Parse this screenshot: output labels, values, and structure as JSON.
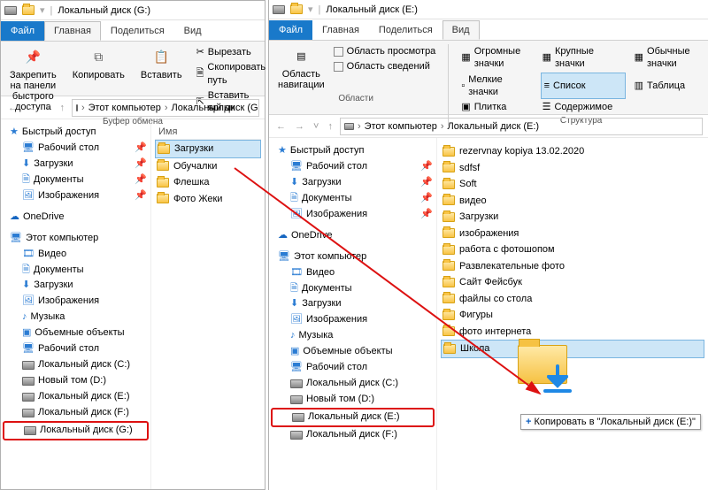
{
  "left": {
    "title": "Локальный диск (G:)",
    "tabs": {
      "file": "Файл",
      "home": "Главная",
      "share": "Поделиться",
      "view": "Вид"
    },
    "ribbon": {
      "pin": "Закрепить на панели\nбыстрого доступа",
      "copy": "Копировать",
      "paste": "Вставить",
      "cut": "Вырезать",
      "copypath": "Скопировать путь",
      "pasteshortcut": "Вставить ярлык",
      "group": "Буфер обмена"
    },
    "breadcrumb": {
      "pc": "Этот компьютер",
      "disk": "Локальный диск (G:"
    },
    "tree": {
      "quick": "Быстрый доступ",
      "desktop": "Рабочий стол",
      "downloads": "Загрузки",
      "documents": "Документы",
      "pictures": "Изображения",
      "onedrive": "OneDrive",
      "thispc": "Этот компьютер",
      "video": "Видео",
      "docs2": "Документы",
      "dl2": "Загрузки",
      "pic2": "Изображения",
      "music": "Музыка",
      "objects": "Объемные объекты",
      "desk2": "Рабочий стол",
      "diskC": "Локальный диск (C:)",
      "diskD": "Новый том (D:)",
      "diskE": "Локальный диск (E:)",
      "diskF": "Локальный диск (F:)",
      "diskG": "Локальный диск (G:)"
    },
    "content": {
      "header": "Имя",
      "items": [
        "Загрузки",
        "Обучалки",
        "Флешка",
        "Фото Жеки"
      ]
    }
  },
  "right": {
    "title": "Локальный диск (E:)",
    "tabs": {
      "file": "Файл",
      "home": "Главная",
      "share": "Поделиться",
      "view": "Вид"
    },
    "ribbon": {
      "navpane": "Область\nнавигации",
      "preview": "Область просмотра",
      "details": "Область сведений",
      "group1": "Области",
      "huge": "Огромные значки",
      "large": "Крупные значки",
      "normal": "Обычные значки",
      "small": "Мелкие значки",
      "list": "Список",
      "table": "Таблица",
      "tiles": "Плитка",
      "contents": "Содержимое",
      "group2": "Структура"
    },
    "breadcrumb": {
      "pc": "Этот компьютер",
      "disk": "Локальный диск (E:)"
    },
    "tree": {
      "quick": "Быстрый доступ",
      "desktop": "Рабочий стол",
      "downloads": "Загрузки",
      "documents": "Документы",
      "pictures": "Изображения",
      "onedrive": "OneDrive",
      "thispc": "Этот компьютер",
      "video": "Видео",
      "docs2": "Документы",
      "dl2": "Загрузки",
      "pic2": "Изображения",
      "music": "Музыка",
      "objects": "Объемные объекты",
      "desk2": "Рабочий стол",
      "diskC": "Локальный диск (C:)",
      "diskD": "Новый том (D:)",
      "diskE": "Локальный диск (E:)",
      "diskF": "Локальный диск (F:)"
    },
    "content": {
      "items": [
        "rezervnay kopiya 13.02.2020",
        "sdfsf",
        "Soft",
        "видео",
        "Загрузки",
        "изображения",
        "работа с фотошопом",
        "Развлекательные фото",
        "Сайт Фейсбук",
        "файлы со стола",
        "Фигуры",
        "фото интернета",
        "Школа"
      ]
    },
    "tooltip": "Копировать в \"Локальный диск (E:)\""
  }
}
